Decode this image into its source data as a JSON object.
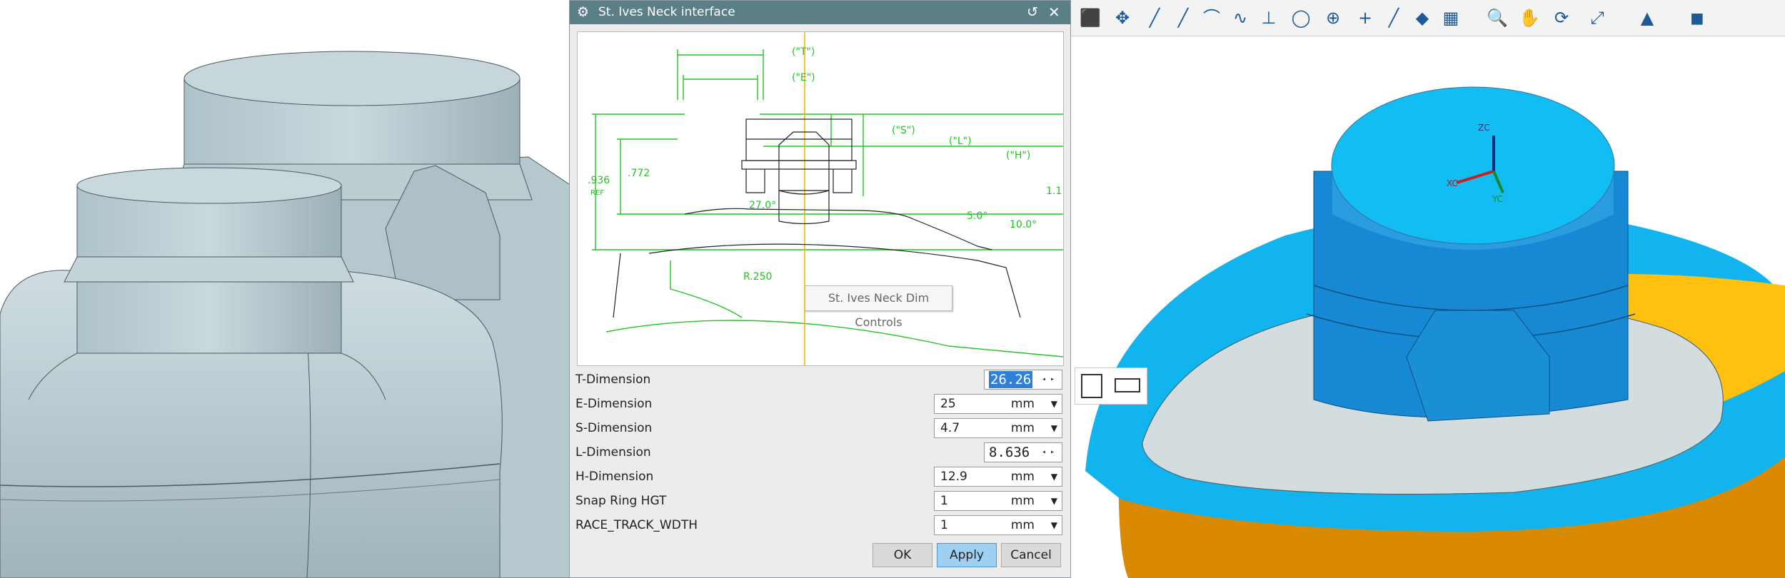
{
  "dialog": {
    "title": "St. Ives Neck interface",
    "tooltip": "St. Ives Neck Dim Controls",
    "fields": [
      {
        "label": "T-Dimension",
        "value": "26.26",
        "unit": "",
        "kind": "spinner",
        "selected": true
      },
      {
        "label": "E-Dimension",
        "value": "25",
        "unit": "mm",
        "kind": "dropdown"
      },
      {
        "label": "S-Dimension",
        "value": "4.7",
        "unit": "mm",
        "kind": "dropdown"
      },
      {
        "label": "L-Dimension",
        "value": "8.636",
        "unit": "",
        "kind": "spinner"
      },
      {
        "label": "H-Dimension",
        "value": "12.9",
        "unit": "mm",
        "kind": "dropdown"
      },
      {
        "label": "Snap Ring HGT",
        "value": "1",
        "unit": "mm",
        "kind": "dropdown"
      },
      {
        "label": "RACE_TRACK_WDTH",
        "value": "1",
        "unit": "mm",
        "kind": "dropdown"
      }
    ],
    "buttons": {
      "ok": "OK",
      "apply": "Apply",
      "cancel": "Cancel"
    }
  },
  "drawing": {
    "labels": {
      "t": "(\"T\")",
      "e": "(\"E\")",
      "s": "(\"S\")",
      "l": "(\"L\")",
      "h": "(\"H\")",
      "ref": "REF",
      "d936": ".936",
      "d772": ".772",
      "ang27": "27.0°",
      "ang5": "5.0°",
      "ang10": "10.0°",
      "r250": "R.250",
      "one": "1.1"
    }
  },
  "axes": {
    "zc": "ZC",
    "xc": "XC",
    "yc": "YC"
  },
  "toolbar_icons": [
    "cube-icon",
    "move-icon",
    "line-icon",
    "line-icon",
    "arc-icon",
    "spline-icon",
    "angle-icon",
    "circle-icon",
    "target-icon",
    "plus-icon",
    "slash-icon",
    "surface-icon",
    "grid-icon",
    "zoom-icon",
    "pan-icon",
    "rotate-icon",
    "fit-icon",
    "shade-icon",
    "solid-icon"
  ],
  "colors": {
    "accent_cyan": "#12b4ef",
    "accent_orange": "#ffb700",
    "model_grey": "#b7cad0",
    "dialog_title": "#5b7f86",
    "apply": "#9fd0f4"
  }
}
